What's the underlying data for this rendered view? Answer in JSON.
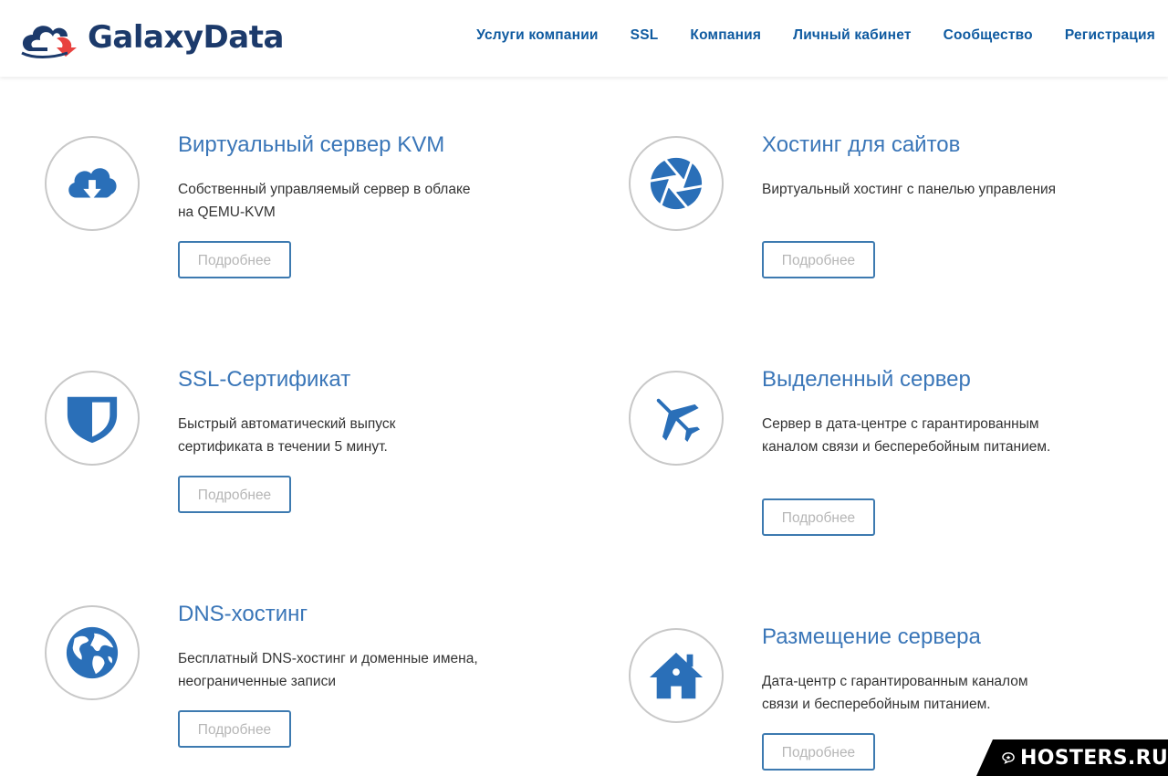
{
  "brand": {
    "name": "GalaxyData"
  },
  "nav": {
    "items": [
      "Услуги компании",
      "SSL",
      "Компания",
      "Личный кабинет",
      "Сообщество",
      "Регистрация"
    ]
  },
  "services": [
    {
      "title": "Виртуальный сервер KVM",
      "description": "Собственный управляемый сервер в облаке на QEMU-KVM",
      "button": "Подробнее",
      "icon": "cloud-download-icon"
    },
    {
      "title": "Хостинг для сайтов",
      "description": "Виртуальный хостинг с панелью управления",
      "button": "Подробнее",
      "icon": "aperture-icon"
    },
    {
      "title": "SSL-Сертификат",
      "description": "Быстрый автоматический выпуск сертификата в течении 5 минут.",
      "button": "Подробнее",
      "icon": "shield-icon"
    },
    {
      "title": "Выделенный сервер",
      "description": "Сервер в дата-центре с гарантированным каналом связи и бесперебойным питанием.",
      "button": "Подробнее",
      "icon": "airplane-icon"
    },
    {
      "title": "DNS-хостинг",
      "description": "Бесплатный DNS-хостинг и доменные имена, неограниченные записи",
      "button": "Подробнее",
      "icon": "globe-icon"
    },
    {
      "title": "Размещение сервера",
      "description": "Дата-центр с гарантированным каналом связи и бесперебойным питанием.",
      "button": "Подробнее",
      "icon": "home-icon"
    }
  ],
  "watermark": {
    "text": "HOSTERS.RU"
  },
  "colors": {
    "accent": "#3a76b8",
    "nav": "#0e5aa0",
    "icon": "#2a6fb8",
    "logo_dark": "#1c3a6b",
    "logo_red": "#e8423f"
  }
}
